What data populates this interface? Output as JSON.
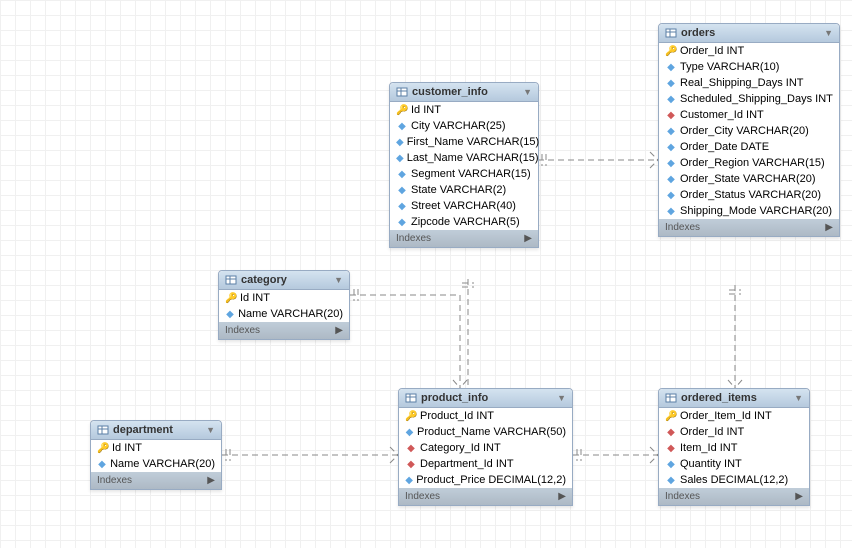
{
  "indexes_label": "Indexes",
  "tables": {
    "orders": {
      "name": "orders",
      "columns": [
        {
          "icon": "pk",
          "text": "Order_Id INT"
        },
        {
          "icon": "reg",
          "text": "Type VARCHAR(10)"
        },
        {
          "icon": "reg",
          "text": "Real_Shipping_Days INT"
        },
        {
          "icon": "reg",
          "text": "Scheduled_Shipping_Days INT"
        },
        {
          "icon": "fk",
          "text": "Customer_Id INT"
        },
        {
          "icon": "reg",
          "text": "Order_City VARCHAR(20)"
        },
        {
          "icon": "reg",
          "text": "Order_Date DATE"
        },
        {
          "icon": "reg",
          "text": "Order_Region VARCHAR(15)"
        },
        {
          "icon": "reg",
          "text": "Order_State VARCHAR(20)"
        },
        {
          "icon": "reg",
          "text": "Order_Status VARCHAR(20)"
        },
        {
          "icon": "reg",
          "text": "Shipping_Mode VARCHAR(20)"
        }
      ]
    },
    "customer_info": {
      "name": "customer_info",
      "columns": [
        {
          "icon": "pk",
          "text": "Id INT"
        },
        {
          "icon": "reg",
          "text": "City VARCHAR(25)"
        },
        {
          "icon": "reg",
          "text": "First_Name VARCHAR(15)"
        },
        {
          "icon": "reg",
          "text": "Last_Name VARCHAR(15)"
        },
        {
          "icon": "reg",
          "text": "Segment VARCHAR(15)"
        },
        {
          "icon": "reg",
          "text": "State VARCHAR(2)"
        },
        {
          "icon": "reg",
          "text": "Street VARCHAR(40)"
        },
        {
          "icon": "reg",
          "text": "Zipcode VARCHAR(5)"
        }
      ]
    },
    "category": {
      "name": "category",
      "columns": [
        {
          "icon": "pk",
          "text": "Id INT"
        },
        {
          "icon": "reg",
          "text": "Name VARCHAR(20)"
        }
      ]
    },
    "product_info": {
      "name": "product_info",
      "columns": [
        {
          "icon": "pk",
          "text": "Product_Id INT"
        },
        {
          "icon": "reg",
          "text": "Product_Name VARCHAR(50)"
        },
        {
          "icon": "fk",
          "text": "Category_Id INT"
        },
        {
          "icon": "fk",
          "text": "Department_Id INT"
        },
        {
          "icon": "reg",
          "text": "Product_Price DECIMAL(12,2)"
        }
      ]
    },
    "department": {
      "name": "department",
      "columns": [
        {
          "icon": "pk",
          "text": "Id INT"
        },
        {
          "icon": "reg",
          "text": "Name VARCHAR(20)"
        }
      ]
    },
    "ordered_items": {
      "name": "ordered_items",
      "columns": [
        {
          "icon": "pk",
          "text": "Order_Item_Id INT"
        },
        {
          "icon": "fk",
          "text": "Order_Id INT"
        },
        {
          "icon": "fk",
          "text": "Item_Id INT"
        },
        {
          "icon": "reg",
          "text": "Quantity INT"
        },
        {
          "icon": "reg",
          "text": "Sales DECIMAL(12,2)"
        }
      ]
    }
  },
  "chart_data": {
    "type": "erd",
    "entities": [
      "orders",
      "customer_info",
      "category",
      "product_info",
      "department",
      "ordered_items"
    ],
    "relationships": [
      {
        "from": "customer_info",
        "from_key": "Id",
        "to": "orders",
        "to_key": "Customer_Id",
        "cardinality": "1:N"
      },
      {
        "from": "orders",
        "from_key": "Order_Id",
        "to": "ordered_items",
        "to_key": "Order_Id",
        "cardinality": "1:N"
      },
      {
        "from": "product_info",
        "from_key": "Product_Id",
        "to": "ordered_items",
        "to_key": "Item_Id",
        "cardinality": "1:N"
      },
      {
        "from": "category",
        "from_key": "Id",
        "to": "product_info",
        "to_key": "Category_Id",
        "cardinality": "1:N"
      },
      {
        "from": "department",
        "from_key": "Id",
        "to": "product_info",
        "to_key": "Department_Id",
        "cardinality": "1:N"
      },
      {
        "from": "customer_info",
        "from_key": "Id",
        "to": "product_info",
        "to_key": null,
        "cardinality": "1:N"
      }
    ]
  }
}
